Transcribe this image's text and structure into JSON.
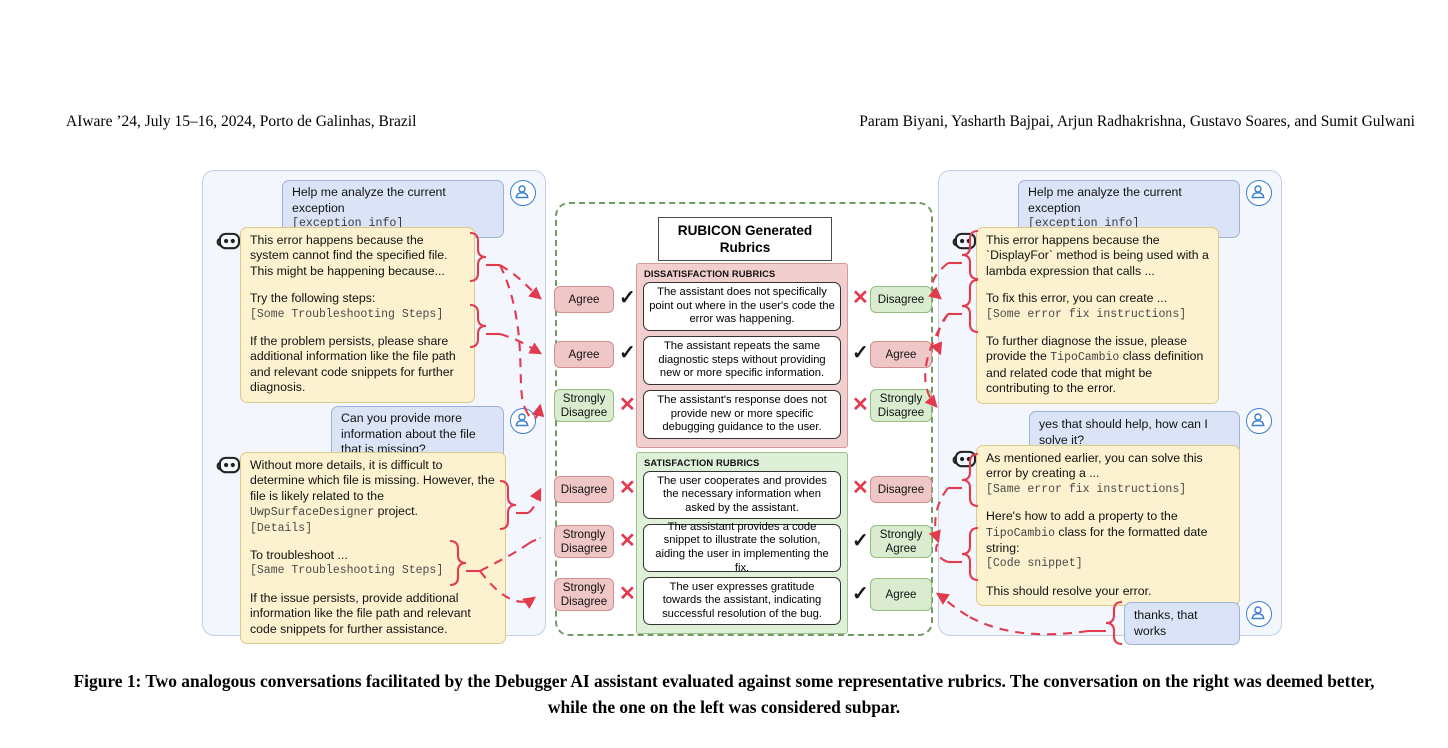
{
  "header": {
    "left": "AIware ’24, July 15–16, 2024, Porto de Galinhas, Brazil",
    "right": "Param Biyani, Yasharth Bajpai, Arjun Radhakrishna, Gustavo Soares, and Sumit Gulwani"
  },
  "caption": "Figure 1: Two analogous conversations facilitated by the Debugger AI assistant evaluated against some representative rubrics. The conversation on the right was deemed better, while the one on the left was considered subpar.",
  "rubric_region": {
    "title": "RUBICON Generated Rubrics",
    "dissatisfaction": {
      "label": "DISSATISFACTION RUBRICS",
      "items": [
        "The assistant does not specifically point out where in the user's code the error was happening.",
        "The assistant repeats the same diagnostic steps without providing new or more specific information.",
        "The assistant's response does not provide new or more specific debugging guidance to the user."
      ]
    },
    "satisfaction": {
      "label": "SATISFACTION RUBRICS",
      "items": [
        "The user cooperates and provides the necessary information when asked by the assistant.",
        "The assistant provides a code snippet to illustrate the solution, aiding the user in implementing the fix.",
        "The user expresses gratitude towards the assistant, indicating successful resolution of the bug."
      ]
    },
    "left_verdicts": [
      {
        "label": "Agree",
        "tone": "neg",
        "mark": "tick"
      },
      {
        "label": "Agree",
        "tone": "neg",
        "mark": "tick"
      },
      {
        "label": "Strongly Disagree",
        "tone": "pos",
        "mark": "cross"
      },
      {
        "label": "Disagree",
        "tone": "neg",
        "mark": "cross"
      },
      {
        "label": "Strongly Disagree",
        "tone": "neg",
        "mark": "cross"
      },
      {
        "label": "Strongly Disagree",
        "tone": "neg",
        "mark": "cross"
      }
    ],
    "right_verdicts": [
      {
        "label": "Disagree",
        "tone": "pos",
        "mark": "cross"
      },
      {
        "label": "Agree",
        "tone": "neg",
        "mark": "tick"
      },
      {
        "label": "Strongly Disagree",
        "tone": "pos",
        "mark": "cross"
      },
      {
        "label": "Disagree",
        "tone": "neg",
        "mark": "cross"
      },
      {
        "label": "Strongly Agree",
        "tone": "pos",
        "mark": "tick"
      },
      {
        "label": "Agree",
        "tone": "pos",
        "mark": "tick"
      }
    ]
  },
  "left_conversation": {
    "u1": {
      "text": "Help me analyze the current exception",
      "mono": "[exception info]"
    },
    "a1": {
      "p1": "This error happens because the system cannot find the specified file. This might be happening because...",
      "p2": "Try the following steps:",
      "p2_mono": "[Some Troubleshooting Steps]",
      "p3": "If the problem persists, please share additional information like the file path and relevant code snippets for further diagnosis."
    },
    "u2": {
      "text": "Can you provide more information about the file that is missing?"
    },
    "a2": {
      "p1_a": "Without more details, it is difficult to determine which file is missing. However, the file is likely related to the ",
      "p1_code": "UwpSurfaceDesigner",
      "p1_b": " project.",
      "p1_mono": "[Details]",
      "p2": "To troubleshoot ...",
      "p2_mono": "[Same Troubleshooting Steps]",
      "p3": "If the issue persists, provide additional information like the file path and relevant code snippets for further assistance."
    }
  },
  "right_conversation": {
    "u1": {
      "text": "Help me analyze the current exception",
      "mono": "[exception info]"
    },
    "a1": {
      "p1": "This error happens because the `DisplayFor` method is being used with a lambda expression that calls ...",
      "p2": "To fix this error, you can create ...",
      "p2_mono": "[Some error fix instructions]",
      "p3_a": "To further diagnose the issue, please provide the ",
      "p3_code": "TipoCambio",
      "p3_b": " class definition and related code that might be contributing to the error."
    },
    "u2": {
      "text": "yes that should help, how can I solve it?"
    },
    "a2": {
      "p1": "As mentioned earlier, you can solve this error by creating a ...",
      "p1_mono": "[Same error fix instructions]",
      "p2_a": "Here's how to add a property to the ",
      "p2_code": "TipoCambio",
      "p2_b": " class for the formatted date string:",
      "p2_mono": "[Code snippet]",
      "p3": "This should resolve your error."
    },
    "u3": {
      "text": "thanks, that works"
    }
  },
  "icons": {
    "user_avatar": "user-avatar-icon",
    "bot_avatar": "bot-avatar-icon",
    "tick": "✓",
    "cross": "✕"
  },
  "colors": {
    "panel_bg": "#f3f6fc",
    "user_bubble": "#dbe4f6",
    "bot_bubble": "#fcf2cf",
    "dissatisfaction": "#f2cfcf",
    "satisfaction": "#dff0d8",
    "accent_red": "#e23b4e",
    "dash_green": "#6f9c63"
  }
}
